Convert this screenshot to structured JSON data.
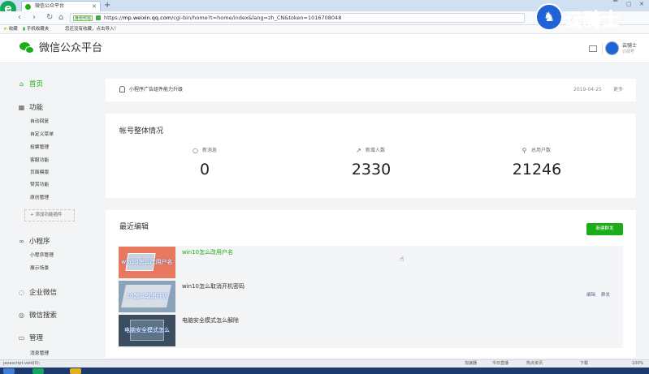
{
  "browser": {
    "tab_title": "微信公众平台",
    "tab_close": "✕",
    "new_tab": "+",
    "secure_label": "身份可信",
    "url_prefix": "https://",
    "url_host": "mp.weixin.qq.com",
    "url_path": "/cgi-bin/home?t=home/index&lang=zh_CN&token=1016708048",
    "bookmarks": [
      {
        "icon": "star-icon",
        "label": "收藏"
      },
      {
        "icon": "phone-icon",
        "label": "手机收藏夹"
      },
      {
        "icon": "",
        "label": "您还没有收藏，点击导入！"
      }
    ],
    "nav": {
      "back": "‹",
      "forward": "›",
      "reload": "↻",
      "home": "⌂"
    }
  },
  "watermark": {
    "text": "云骑士"
  },
  "header": {
    "title": "微信公众平台",
    "account_name": "云骑士",
    "account_type": "订阅号"
  },
  "sidebar": {
    "home": {
      "label": "首页",
      "icon": "house-icon"
    },
    "function": {
      "label": "功能",
      "icon": "grid-icon"
    },
    "function_items": [
      "自动回复",
      "自定义菜单",
      "投票管理",
      "客服功能",
      "页面模版",
      "赞赏功能",
      "原创管理"
    ],
    "add_plugin": "+ 添加功能插件",
    "miniprogram": {
      "label": "小程序",
      "icon": "link-icon"
    },
    "miniprogram_items": [
      "小程序管理",
      "展示场景"
    ],
    "work_wechat": {
      "label": "企业微信",
      "icon": "chat-icon"
    },
    "wechat_search": {
      "label": "微信搜索",
      "icon": "search-icon"
    },
    "manage": {
      "label": "管理",
      "icon": "folder-icon"
    },
    "manage_items": [
      "消息管理"
    ]
  },
  "notice": {
    "text": "小程序广告组件能力升级",
    "date": "2019-04-25",
    "more": "更多"
  },
  "overview": {
    "title": "帐号整体情况",
    "stats": [
      {
        "label": "新消息",
        "value": "0",
        "icon": "message-icon"
      },
      {
        "label": "新增人数",
        "value": "2330",
        "icon": "trend-icon"
      },
      {
        "label": "总用户数",
        "value": "21246",
        "icon": "user-icon"
      }
    ]
  },
  "recent": {
    "title": "最近编辑",
    "new_button": "新建群发",
    "items": [
      {
        "title": "win10怎么改用户名",
        "thumb_text": "win10怎么改用户名",
        "thumb_color": "#e8795e"
      },
      {
        "title": "win10怎么取消开机密码",
        "thumb_text": "10怎么取消开机",
        "thumb_color": "#8aa3b8"
      },
      {
        "title": "电脑安全模式怎么解除",
        "thumb_text": "电脑安全模式怎么",
        "thumb_color": "#3c4d5f"
      }
    ],
    "actions": {
      "edit": "编辑",
      "send": "群发"
    }
  },
  "statusbar": {
    "left": "javascript:void(0);",
    "items": [
      "加速器",
      "今日直播",
      "热点资讯",
      "下载",
      "100%"
    ]
  },
  "colors": {
    "brand": "#1aad19",
    "watermark": "#1f63d6"
  }
}
